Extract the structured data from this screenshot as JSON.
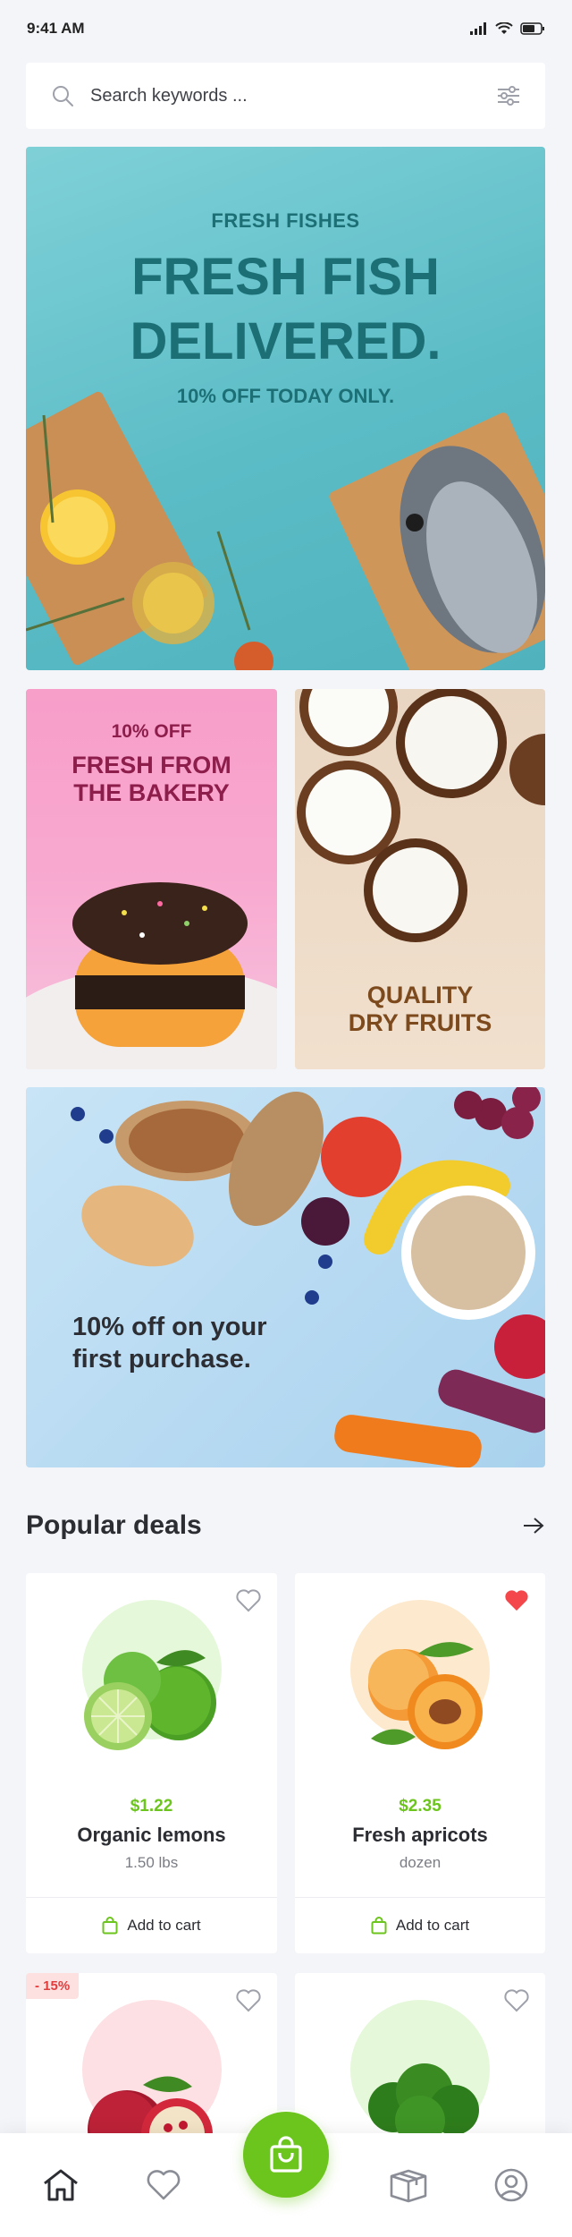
{
  "status": {
    "time": "9:41 AM"
  },
  "search": {
    "placeholder": "Search keywords ..."
  },
  "banners": {
    "hero": {
      "eyebrow": "FRESH FISHES",
      "title_line1": "FRESH FISH",
      "title_line2": "DELIVERED.",
      "subtitle": "10% OFF TODAY ONLY."
    },
    "bakery": {
      "eyebrow": "10% OFF",
      "title_line1": "FRESH FROM",
      "title_line2": "THE BAKERY"
    },
    "fruits": {
      "title_line1": "QUALITY",
      "title_line2": "DRY FRUITS"
    },
    "promo": {
      "text_line1": "10% off on your",
      "text_line2": "first purchase."
    }
  },
  "popular": {
    "title": "Popular deals",
    "products": [
      {
        "price": "$1.22",
        "name": "Organic lemons",
        "unit": "1.50 lbs",
        "cart_label": "Add to cart",
        "favorite": false
      },
      {
        "price": "$2.35",
        "name": "Fresh apricots",
        "unit": "dozen",
        "cart_label": "Add to cart",
        "favorite": true
      },
      {
        "badge": "- 15%",
        "favorite": false
      },
      {
        "favorite": false
      }
    ]
  },
  "colors": {
    "accent": "#6cc51d",
    "favorite": "#f4474b",
    "background": "#f4f5f9"
  },
  "icons": [
    "search-icon",
    "filter-icon",
    "heart-icon",
    "bag-icon",
    "home-icon",
    "package-icon",
    "user-icon",
    "arrow-right-icon"
  ]
}
